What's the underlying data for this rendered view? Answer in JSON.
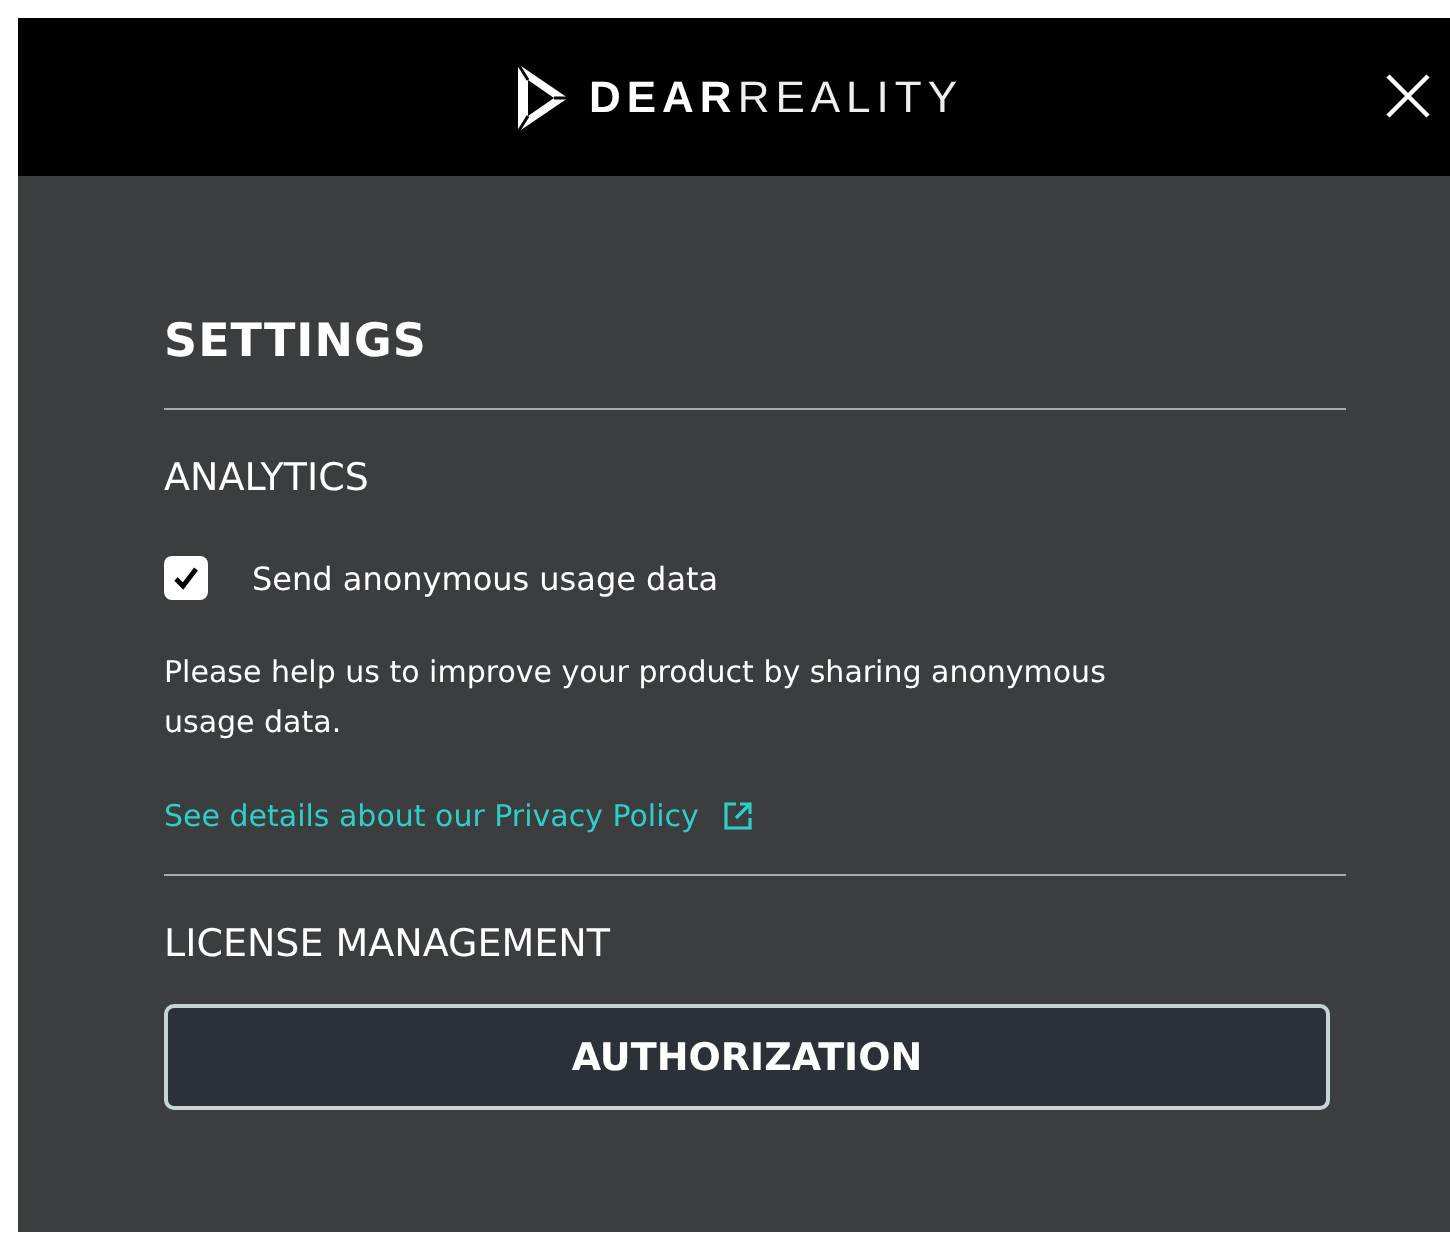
{
  "header": {
    "logo": "**DEAR**REALITY"
  },
  "title": "SETTINGS",
  "analytics": {
    "heading": "ANALYTICS",
    "checkbox": {
      "label": "Send anonymous usage data",
      "checked": true
    },
    "description": "Please help us to improve your product by sharing anonymous usage data.",
    "link": "See details about our Privacy Policy"
  },
  "license": {
    "heading": "LICENSE MANAGEMENT",
    "button": "AUTHORIZATION"
  }
}
